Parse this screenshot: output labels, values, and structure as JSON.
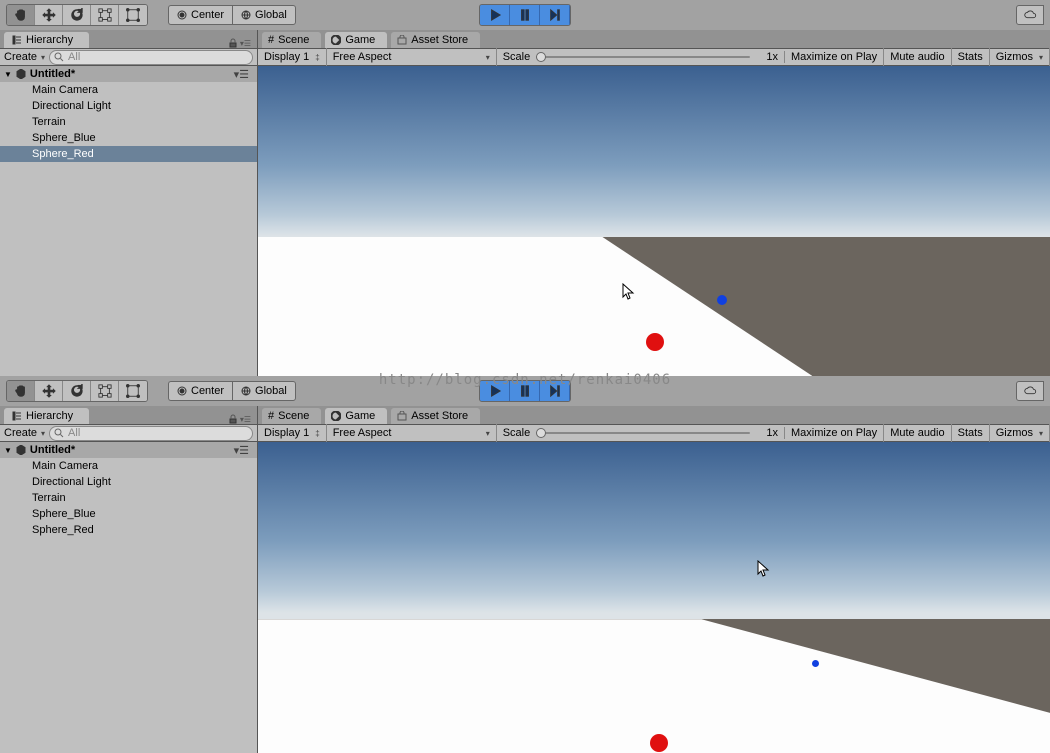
{
  "toolbar": {
    "pivot_center": "Center",
    "pivot_global": "Global"
  },
  "hierarchy": {
    "tab_label": "Hierarchy",
    "create_label": "Create",
    "search_placeholder": "All",
    "scene_name": "Untitled*",
    "items": [
      "Main Camera",
      "Directional Light",
      "Terrain",
      "Sphere_Blue",
      "Sphere_Red"
    ]
  },
  "view": {
    "tabs": {
      "scene": "Scene",
      "game": "Game",
      "asset_store": "Asset Store"
    },
    "game_toolbar": {
      "display": "Display 1",
      "aspect": "Free Aspect",
      "scale_label": "Scale",
      "scale_value": "1x",
      "maximize": "Maximize on Play",
      "mute": "Mute audio",
      "stats": "Stats",
      "gizmos": "Gizmos"
    }
  },
  "watermark": "http://blog.csdn.net/renkai0406"
}
